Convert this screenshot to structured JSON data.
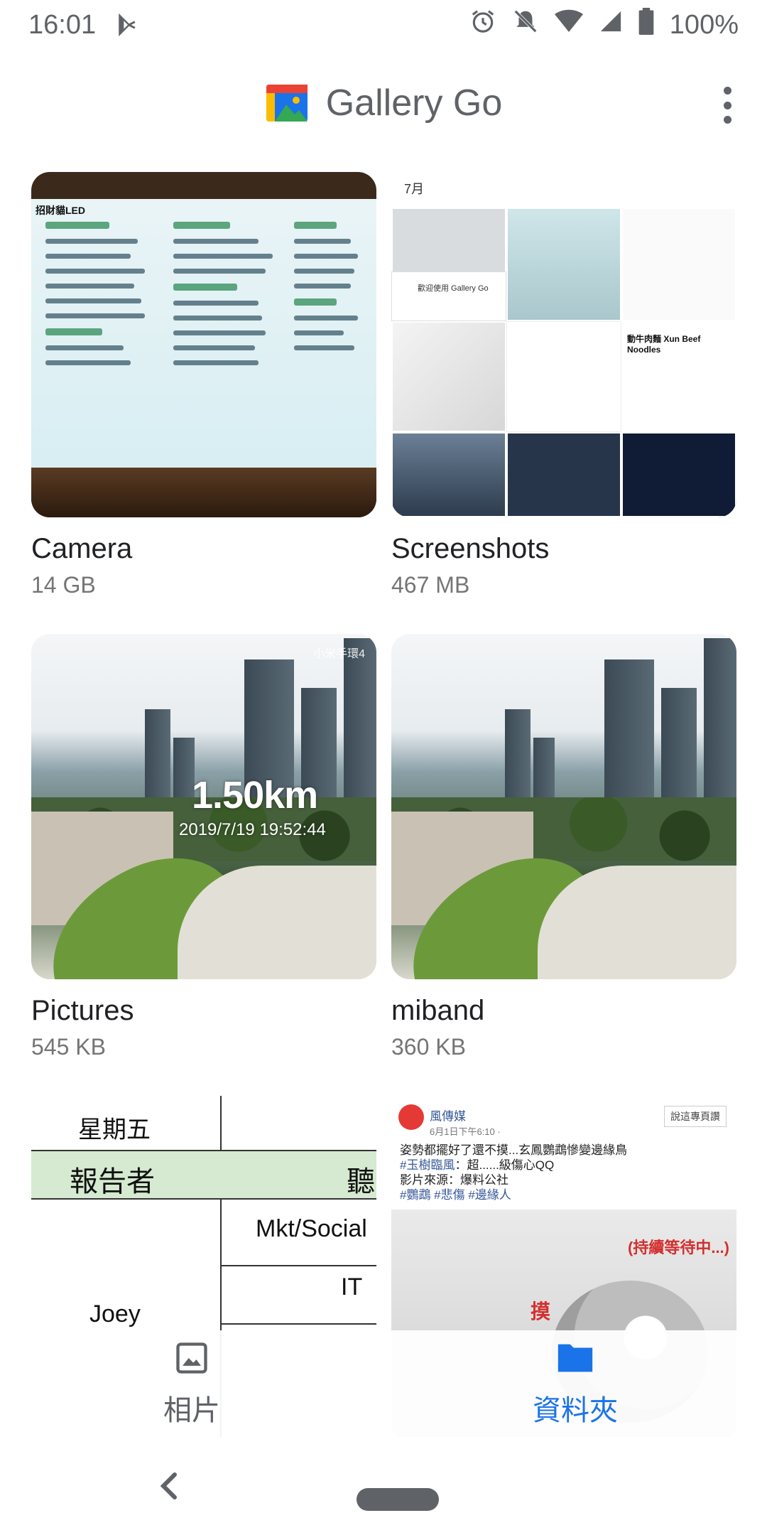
{
  "status_bar": {
    "time": "16:01",
    "battery": "100%",
    "icons": [
      "play-store-notification-icon",
      "alarm-icon",
      "silent-icon",
      "wifi-icon",
      "signal-icon",
      "battery-icon"
    ]
  },
  "app_bar": {
    "title": "Gallery Go",
    "more_icon": "more-vert-icon"
  },
  "folders": [
    {
      "name": "Camera",
      "size": "14 GB",
      "thumb_text": "招財貓LED"
    },
    {
      "name": "Screenshots",
      "size": "467 MB",
      "thumb_text": {
        "month": "7月",
        "welcome": "歡迎使用 Gallery Go",
        "noodles": "動牛肉麵 Xun Beef Noodles"
      }
    },
    {
      "name": "Pictures",
      "size": "545 KB",
      "thumb_text": {
        "distance": "1.50km",
        "datetime": "2019/7/19 19:52:44",
        "brand": "小米手環4"
      }
    },
    {
      "name": "miband",
      "size": "360 KB"
    },
    {
      "name": "",
      "size": "",
      "thumb_text": {
        "day": "星期五",
        "reporter": "報告者",
        "listen": "聽",
        "mkt": "Mkt/Social",
        "it": "IT",
        "joey": "Joey"
      }
    },
    {
      "name": "",
      "size": "",
      "thumb_text": {
        "page": "風傳媒",
        "date": "6月1日下午6:10 · ",
        "follow": "說這專頁讚",
        "line1": "姿勢都擺好了還不摸...玄鳳鸚鵡慘變邊緣鳥",
        "line2_tag": "#玉樹臨風",
        "line2_rest": "：超......級傷心QQ",
        "line3": "影片來源：爆料公社",
        "line4": "#鸚鵡 #悲傷 #邊緣人",
        "waiting": "(持續等待中...)",
        "touch": "摸"
      }
    }
  ],
  "bottom_nav": {
    "items": [
      {
        "label": "相片",
        "icon": "photo-icon",
        "active": false
      },
      {
        "label": "資料夾",
        "icon": "folder-icon",
        "active": true
      }
    ]
  },
  "colors": {
    "accent": "#1a73e8",
    "text_primary": "#202124",
    "text_secondary": "#757575"
  }
}
